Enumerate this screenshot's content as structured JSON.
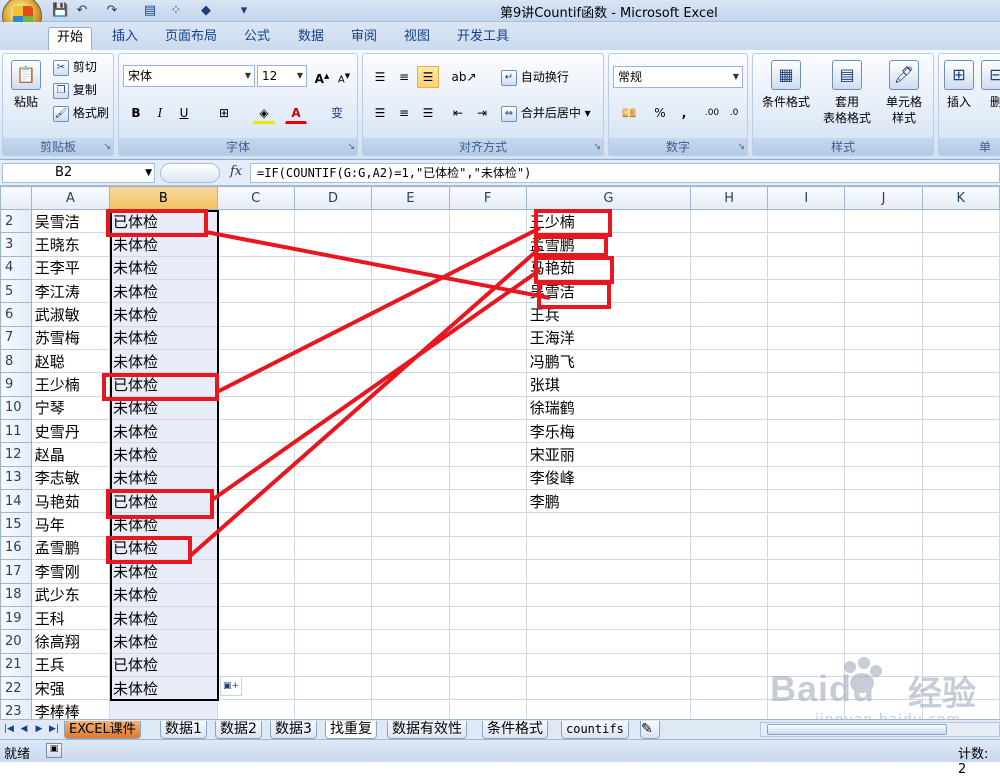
{
  "window": {
    "title": "第9讲Countif函数 - Microsoft Excel"
  },
  "ribbon_tabs": [
    "开始",
    "插入",
    "页面布局",
    "公式",
    "数据",
    "审阅",
    "视图",
    "开发工具"
  ],
  "clipboard": {
    "paste": "粘贴",
    "cut": "剪切",
    "copy": "复制",
    "format_painter": "格式刷",
    "group": "剪贴板"
  },
  "font": {
    "name": "宋体",
    "size": "12",
    "bold": "B",
    "italic": "I",
    "underline": "U",
    "group": "字体",
    "wen": "变"
  },
  "alignment": {
    "wrap": "自动换行",
    "merge": "合并后居中",
    "group": "对齐方式"
  },
  "number": {
    "format": "常规",
    "percent": "%",
    "comma": ",",
    "group": "数字"
  },
  "styles": {
    "conditional": "条件格式",
    "table_fmt_1": "套用",
    "table_fmt_2": "表格格式",
    "cell_styles_1": "单元格",
    "cell_styles_2": "样式",
    "group": "样式"
  },
  "cells": {
    "insert": "插入",
    "delete": "删",
    "group": "单"
  },
  "formula_bar": {
    "name_box": "B2",
    "fx": "fx",
    "formula": "=IF(COUNTIF(G:G,A2)=1,\"已体检\",\"未体检\")"
  },
  "columns": [
    "A",
    "B",
    "C",
    "D",
    "E",
    "F",
    "G",
    "H",
    "I",
    "J",
    "K"
  ],
  "rows": [
    {
      "n": "2",
      "a": "吴雪洁",
      "b": "已体检",
      "g": "王少楠"
    },
    {
      "n": "3",
      "a": "王晓东",
      "b": "未体检",
      "g": "孟雪鹏"
    },
    {
      "n": "4",
      "a": "王李平",
      "b": "未体检",
      "g": "马艳茹"
    },
    {
      "n": "5",
      "a": "李江涛",
      "b": "未体检",
      "g": "吴雪洁"
    },
    {
      "n": "6",
      "a": "武淑敏",
      "b": "未体检",
      "g": "王兵"
    },
    {
      "n": "7",
      "a": "苏雪梅",
      "b": "未体检",
      "g": "王海洋"
    },
    {
      "n": "8",
      "a": "赵聪",
      "b": "未体检",
      "g": "冯鹏飞"
    },
    {
      "n": "9",
      "a": "王少楠",
      "b": "已体检",
      "g": "张琪"
    },
    {
      "n": "10",
      "a": "宁琴",
      "b": "未体检",
      "g": "徐瑞鹤"
    },
    {
      "n": "11",
      "a": "史雪丹",
      "b": "未体检",
      "g": "李乐梅"
    },
    {
      "n": "12",
      "a": "赵晶",
      "b": "未体检",
      "g": "宋亚丽"
    },
    {
      "n": "13",
      "a": "李志敏",
      "b": "未体检",
      "g": "李俊峰"
    },
    {
      "n": "14",
      "a": "马艳茹",
      "b": "已体检",
      "g": "李鹏"
    },
    {
      "n": "15",
      "a": "马年",
      "b": "未体检",
      "g": ""
    },
    {
      "n": "16",
      "a": "孟雪鹏",
      "b": "已体检",
      "g": ""
    },
    {
      "n": "17",
      "a": "李雪刚",
      "b": "未体检",
      "g": ""
    },
    {
      "n": "18",
      "a": "武少东",
      "b": "未体检",
      "g": ""
    },
    {
      "n": "19",
      "a": "王科",
      "b": "未体检",
      "g": ""
    },
    {
      "n": "20",
      "a": "徐高翔",
      "b": "未体检",
      "g": ""
    },
    {
      "n": "21",
      "a": "王兵",
      "b": "已体检",
      "g": ""
    },
    {
      "n": "22",
      "a": "宋强",
      "b": "未体检",
      "g": ""
    },
    {
      "n": "23",
      "a": "李棒棒",
      "b": "",
      "g": ""
    }
  ],
  "sheet_tabs": [
    "EXCEL课件",
    "数据1",
    "数据2",
    "数据3",
    "找重复",
    "数据有效性",
    "条件格式",
    "countifs"
  ],
  "active_sheet": "找重复",
  "status": {
    "ready": "就绪",
    "count": "计数: 2"
  },
  "watermark": {
    "brand": "Bai",
    "suffix": "du",
    "jingyan": "经验",
    "url": "jingyan.baidu.com"
  },
  "annotation_color": "#e8171f"
}
